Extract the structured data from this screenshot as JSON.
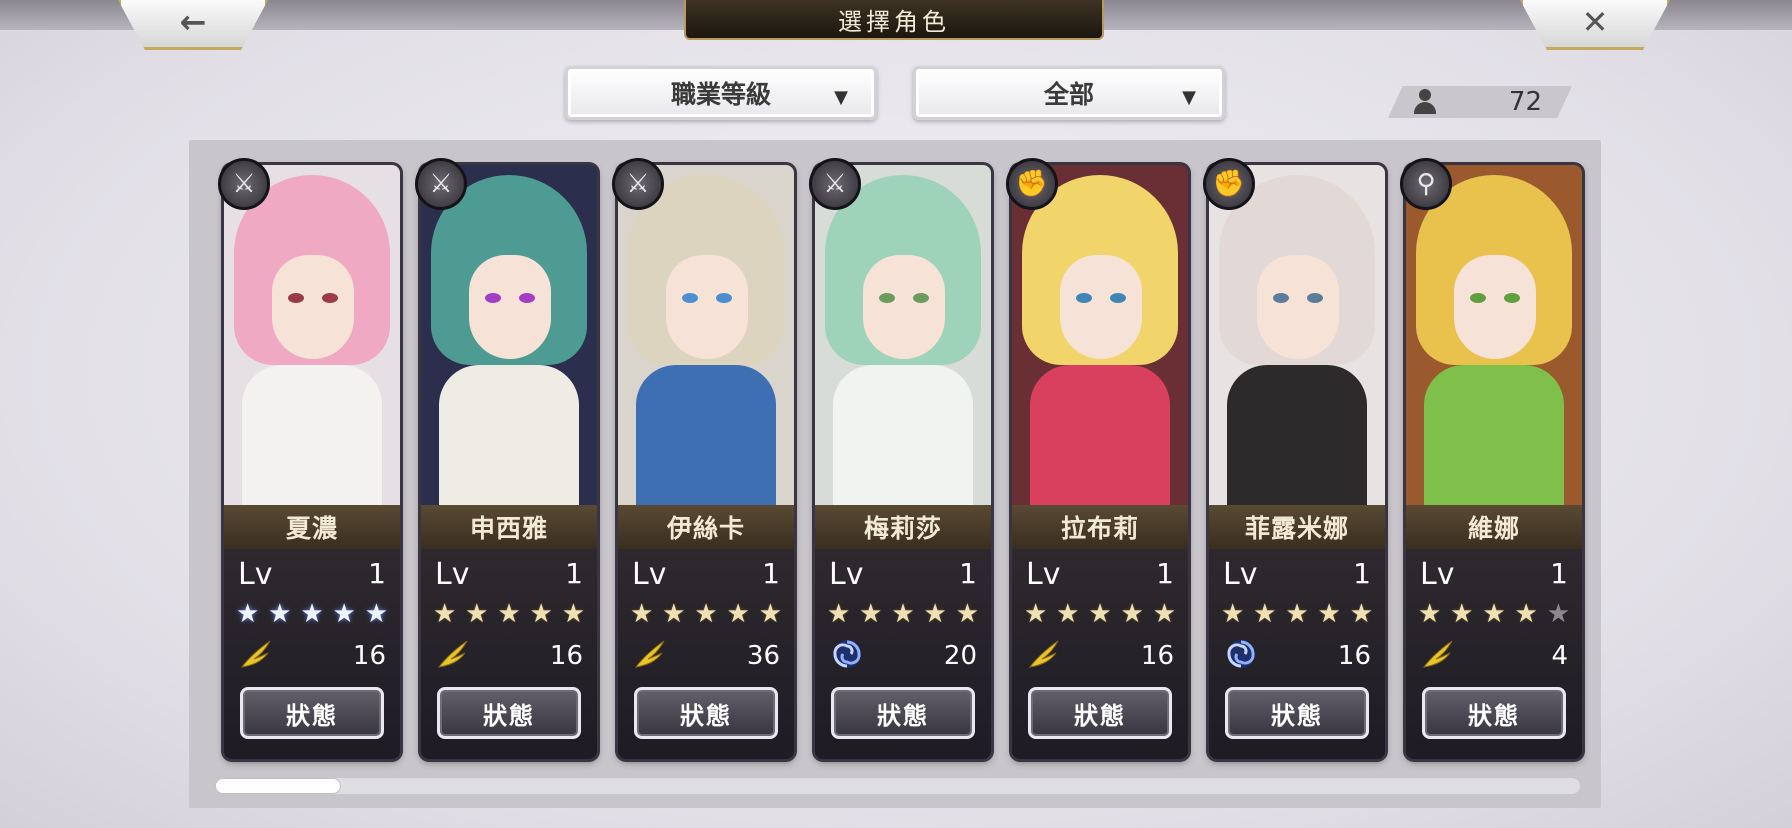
{
  "header": {
    "title": "選擇角色",
    "back_glyph": "←",
    "close_glyph": "✕"
  },
  "filters": {
    "sort": {
      "label": "職業等級",
      "arrow": "▼"
    },
    "category": {
      "label": "全部",
      "arrow": "▼"
    }
  },
  "character_count": "72",
  "characters": [
    {
      "name": "夏濃",
      "lv_label": "Lv",
      "level": "1",
      "stars": 5,
      "star_color": "blue",
      "element_icon": "wing-icon",
      "stat": "16",
      "button": "狀態",
      "class_icon": "sword-icon",
      "class_glyph": "⚔",
      "colors": {
        "bg": "#e6e0e4",
        "hair": "#f0a9c2",
        "body": "#f4f2f0",
        "eye": "#9b3b4a"
      }
    },
    {
      "name": "申西雅",
      "lv_label": "Lv",
      "level": "1",
      "stars": 5,
      "star_color": "gold",
      "element_icon": "wing-icon",
      "stat": "16",
      "button": "狀態",
      "class_icon": "sword-icon",
      "class_glyph": "⚔",
      "colors": {
        "bg": "#2b2f4d",
        "hair": "#4e9b93",
        "body": "#efece6",
        "eye": "#a23ec3"
      }
    },
    {
      "name": "伊絲卡",
      "lv_label": "Lv",
      "level": "1",
      "stars": 5,
      "star_color": "gold",
      "element_icon": "wing-icon",
      "stat": "36",
      "button": "狀態",
      "class_icon": "blade-icon",
      "class_glyph": "⚔",
      "colors": {
        "bg": "#d9d4cc",
        "hair": "#ddd4bf",
        "body": "#3d6fb2",
        "eye": "#4c8fd1"
      }
    },
    {
      "name": "梅莉莎",
      "lv_label": "Lv",
      "level": "1",
      "stars": 5,
      "star_color": "gold",
      "element_icon": "vortex-icon",
      "stat": "20",
      "button": "狀態",
      "class_icon": "blade-icon",
      "class_glyph": "⚔",
      "colors": {
        "bg": "#d8dcd8",
        "hair": "#9fd3b9",
        "body": "#f1f3f1",
        "eye": "#6b9c5c"
      }
    },
    {
      "name": "拉布莉",
      "lv_label": "Lv",
      "level": "1",
      "stars": 5,
      "star_color": "gold",
      "element_icon": "wing-icon",
      "stat": "16",
      "button": "狀態",
      "class_icon": "fist-icon",
      "class_glyph": "✊",
      "colors": {
        "bg": "#6a2f35",
        "hair": "#f1d46a",
        "body": "#d8405d",
        "eye": "#3f86b7"
      }
    },
    {
      "name": "菲露米娜",
      "lv_label": "Lv",
      "level": "1",
      "stars": 5,
      "star_color": "gold",
      "element_icon": "vortex-icon",
      "stat": "16",
      "button": "狀態",
      "class_icon": "fist-icon",
      "class_glyph": "✊",
      "colors": {
        "bg": "#e7e3e2",
        "hair": "#e2d9d6",
        "body": "#2d2a2c",
        "eye": "#5a7e9a"
      }
    },
    {
      "name": "維娜",
      "lv_label": "Lv",
      "level": "1",
      "stars": 4,
      "star_color": "gold",
      "element_icon": "wing-icon",
      "stat": "4",
      "button": "狀態",
      "class_icon": "staff-icon",
      "class_glyph": "⚲",
      "colors": {
        "bg": "#9a5a2d",
        "hair": "#e8c24d",
        "body": "#7fc04a",
        "eye": "#5f9f3e"
      }
    }
  ]
}
